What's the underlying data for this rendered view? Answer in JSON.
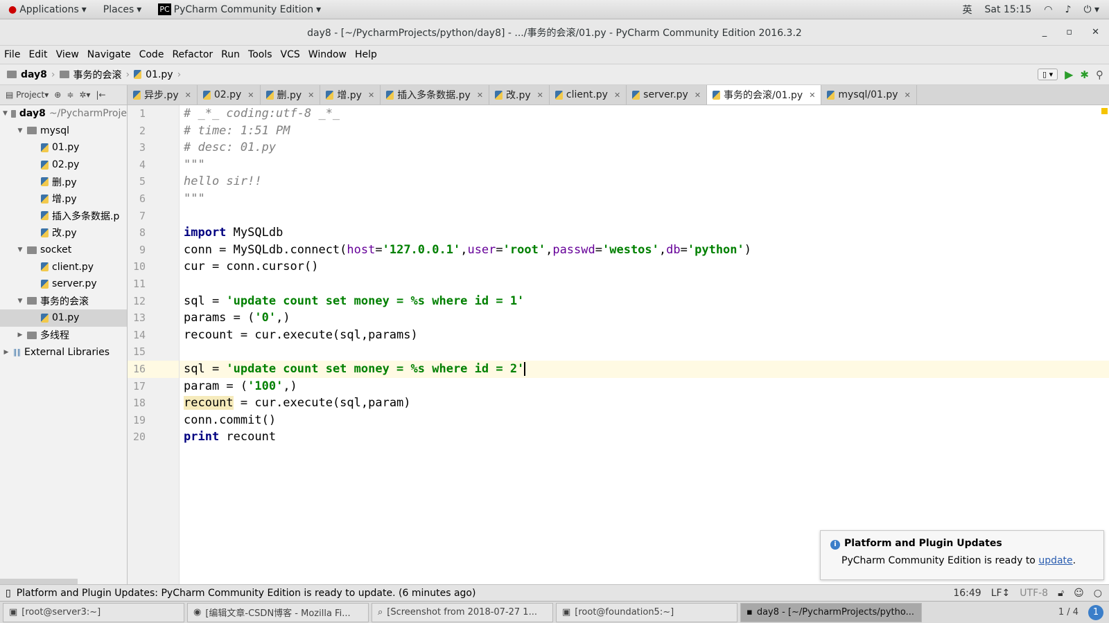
{
  "topbar": {
    "applications": "Applications",
    "places": "Places",
    "app": "PyCharm Community Edition",
    "lang": "英",
    "clock": "Sat 15:15"
  },
  "window": {
    "title": "day8 - [~/PycharmProjects/python/day8] - .../事务的会滚/01.py - PyCharm Community Edition 2016.3.2"
  },
  "menu": [
    "File",
    "Edit",
    "View",
    "Navigate",
    "Code",
    "Refactor",
    "Run",
    "Tools",
    "VCS",
    "Window",
    "Help"
  ],
  "breadcrumb": [
    "day8",
    "事务的会滚",
    "01.py"
  ],
  "project_label": "Project",
  "tabs": [
    {
      "label": "异步.py"
    },
    {
      "label": "02.py"
    },
    {
      "label": "删.py"
    },
    {
      "label": "增.py"
    },
    {
      "label": "插入多条数据.py"
    },
    {
      "label": "改.py"
    },
    {
      "label": "client.py"
    },
    {
      "label": "server.py"
    },
    {
      "label": "事务的会滚/01.py",
      "active": true
    },
    {
      "label": "mysql/01.py"
    }
  ],
  "tree": [
    {
      "label": "day8",
      "extra": "~/PycharmProje",
      "level": 0,
      "type": "folder",
      "open": true,
      "bold": true
    },
    {
      "label": "mysql",
      "level": 1,
      "type": "folder",
      "open": true
    },
    {
      "label": "01.py",
      "level": 2,
      "type": "py"
    },
    {
      "label": "02.py",
      "level": 2,
      "type": "py"
    },
    {
      "label": "删.py",
      "level": 2,
      "type": "py"
    },
    {
      "label": "增.py",
      "level": 2,
      "type": "py"
    },
    {
      "label": "插入多条数据.p",
      "level": 2,
      "type": "py"
    },
    {
      "label": "改.py",
      "level": 2,
      "type": "py"
    },
    {
      "label": "socket",
      "level": 1,
      "type": "folder",
      "open": true
    },
    {
      "label": "client.py",
      "level": 2,
      "type": "py"
    },
    {
      "label": "server.py",
      "level": 2,
      "type": "py"
    },
    {
      "label": "事务的会滚",
      "level": 1,
      "type": "folder",
      "open": true
    },
    {
      "label": "01.py",
      "level": 2,
      "type": "py",
      "selected": true
    },
    {
      "label": "多线程",
      "level": 1,
      "type": "folder",
      "open": false
    },
    {
      "label": "External Libraries",
      "level": 0,
      "type": "lib",
      "open": false
    }
  ],
  "code": [
    [
      [
        "# _*_ coding:utf-8 _*_",
        "comment"
      ]
    ],
    [
      [
        "# time: 1:51 PM",
        "comment"
      ]
    ],
    [
      [
        "# desc: 01.py",
        "comment"
      ]
    ],
    [
      [
        "\"\"\"",
        "comment"
      ]
    ],
    [
      [
        "hello sir!!",
        "comment"
      ]
    ],
    [
      [
        "\"\"\"",
        "comment"
      ]
    ],
    [],
    [
      [
        "import",
        "kw"
      ],
      [
        " MySQLdb",
        ""
      ]
    ],
    [
      [
        "conn = MySQLdb.connect(",
        ""
      ],
      [
        "host",
        "kwarg"
      ],
      [
        "=",
        ""
      ],
      [
        "'127.0.0.1'",
        "str"
      ],
      [
        ",",
        ""
      ],
      [
        "user",
        "kwarg"
      ],
      [
        "=",
        ""
      ],
      [
        "'root'",
        "str"
      ],
      [
        ",",
        ""
      ],
      [
        "passwd",
        "kwarg"
      ],
      [
        "=",
        ""
      ],
      [
        "'westos'",
        "str"
      ],
      [
        ",",
        ""
      ],
      [
        "db",
        "kwarg"
      ],
      [
        "=",
        ""
      ],
      [
        "'python'",
        "str"
      ],
      [
        ")",
        ""
      ]
    ],
    [
      [
        "cur = conn.cursor()",
        ""
      ]
    ],
    [],
    [
      [
        "sql = ",
        ""
      ],
      [
        "'update count set money = %s where id = 1'",
        "str"
      ]
    ],
    [
      [
        "params = (",
        ""
      ],
      [
        "'0'",
        "str"
      ],
      [
        ",)",
        ""
      ]
    ],
    [
      [
        "recount = cur.execute(sql,params)",
        ""
      ]
    ],
    [],
    [
      [
        "sql = ",
        ""
      ],
      [
        "'update count set money = %s where id = 2'",
        "str"
      ]
    ],
    [
      [
        "param = (",
        ""
      ],
      [
        "'100'",
        "str"
      ],
      [
        ",)",
        ""
      ]
    ],
    [
      [
        "recount",
        "hl"
      ],
      [
        " = cur.execute(sql,param)",
        ""
      ]
    ],
    [
      [
        "conn.commit()",
        ""
      ]
    ],
    [
      [
        "print",
        "kw"
      ],
      [
        " recount",
        ""
      ]
    ]
  ],
  "cursor_line": 16,
  "notification": {
    "title": "Platform and Plugin Updates",
    "text": "PyCharm Community Edition is ready to ",
    "link": "update",
    "end": "."
  },
  "status": {
    "message": "Platform and Plugin Updates: PyCharm Community Edition is ready to update. (6 minutes ago)",
    "position": "16:49",
    "line_sep": "LF↕",
    "encoding": "UTF-8"
  },
  "taskbar": {
    "items": [
      "[root@server3:~]",
      "[编辑文章-CSDN博客 - Mozilla Fi...",
      "[Screenshot from 2018-07-27 1...",
      "[root@foundation5:~]",
      "day8 - [~/PycharmProjects/pytho..."
    ],
    "workspace": "1 / 4"
  }
}
